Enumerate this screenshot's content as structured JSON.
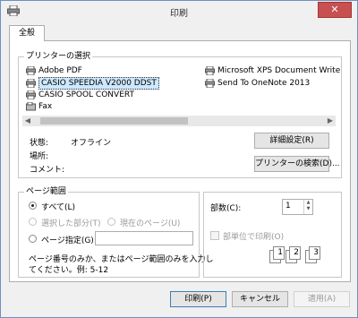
{
  "window": {
    "title": "印刷",
    "close_glyph": "✕"
  },
  "tabs": [
    {
      "label": "全般"
    }
  ],
  "printer_select": {
    "group_label": "プリンターの選択",
    "printers": [
      {
        "name": "Adobe PDF",
        "selected": false
      },
      {
        "name": "CASIO SPEEDIA V2000 DDST",
        "selected": true
      },
      {
        "name": "CASIO SPOOL CONVERT",
        "selected": false
      },
      {
        "name": "Fax",
        "selected": false
      },
      {
        "name": "Microsoft XPS Document Write",
        "selected": false
      },
      {
        "name": "Send To OneNote 2013",
        "selected": false
      }
    ],
    "status_label": "状態:",
    "status_value": "オフライン",
    "location_label": "場所:",
    "location_value": "",
    "comment_label": "コメント:",
    "comment_value": "",
    "preferences_button": "詳細設定(R)",
    "find_printer_button": "プリンターの検索(D)..."
  },
  "page_range": {
    "group_label": "ページ範囲",
    "all_label": "すべて(L)",
    "selection_label": "選択した部分(T)",
    "current_page_label": "現在のページ(U)",
    "pages_label": "ページ指定(G):",
    "pages_value": "",
    "selected": "all",
    "help_text_1": "ページ番号のみか、またはページ範囲のみを入力し",
    "help_text_2": "てください。例: 5-12"
  },
  "copies": {
    "label": "部数(C):",
    "value": "1",
    "collate_label": "部単位で印刷(O)",
    "collate_checked": false,
    "collate_enabled": false,
    "collate_pages": [
      "1",
      "1",
      "2",
      "2",
      "3",
      "3"
    ]
  },
  "footer": {
    "print_button": "印刷(P)",
    "cancel_button": "キャンセル",
    "apply_button": "適用(A)"
  }
}
